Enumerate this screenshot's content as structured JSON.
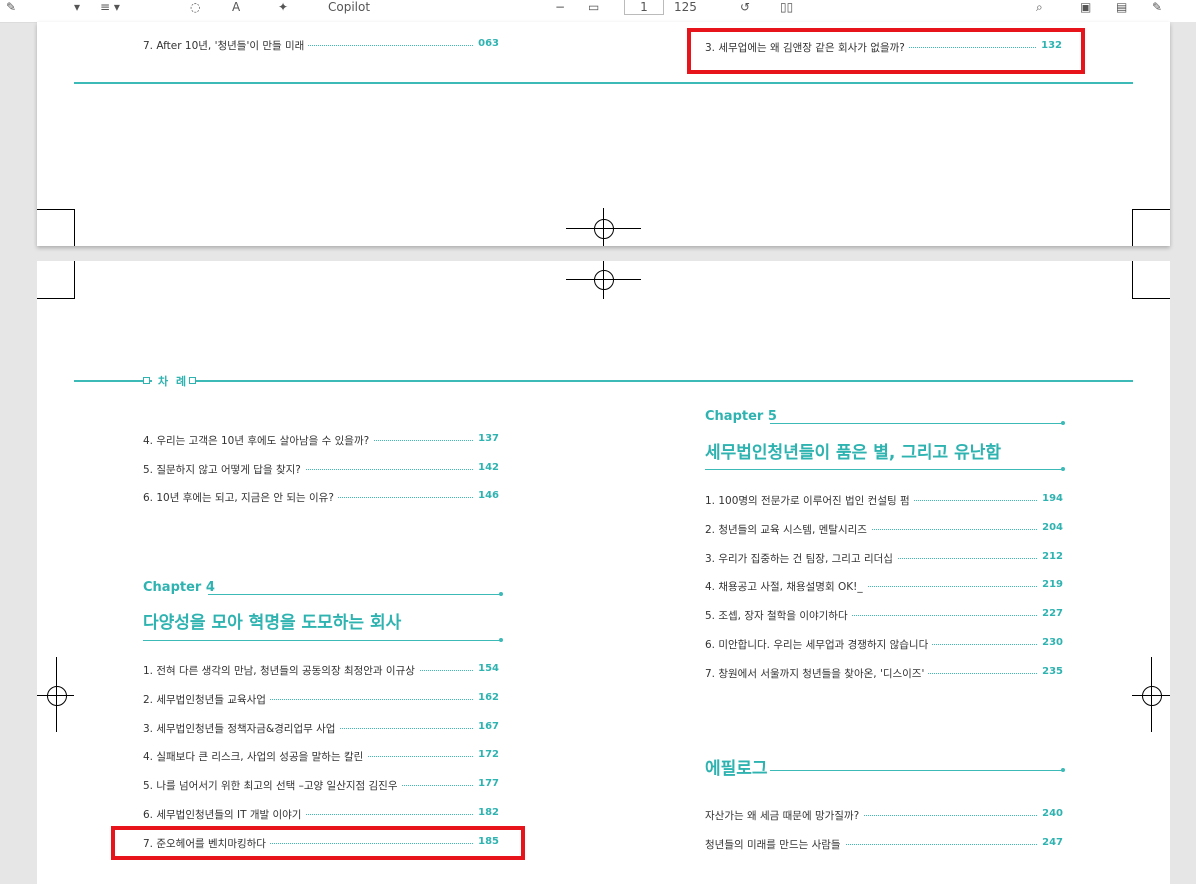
{
  "toolbar": {
    "copilot_label": "Copilot",
    "page_number": "1",
    "zoom": "125"
  },
  "colors": {
    "accent": "#2fb3b1",
    "highlight": "#e8141b"
  },
  "page1": {
    "left_item": {
      "text": "7. After 10년, '청년들'이 만들 미래",
      "page": "063"
    },
    "right_item": {
      "text": "3. 세무업에는 왜 김앤장 같은 회사가 없을까?",
      "page": "132"
    }
  },
  "page2": {
    "toc_label": "차 례",
    "left_items_top": [
      {
        "text": "4. 우리는 고객은 10년 후에도 살아남을 수 있을까?",
        "page": "137"
      },
      {
        "text": "5. 질문하지 않고 어떻게 답을 찾지?",
        "page": "142"
      },
      {
        "text": "6. 10년 후에는 되고, 지금은 안 되는 이유?",
        "page": "146"
      }
    ],
    "chapter4": {
      "label": "Chapter 4",
      "title": "다양성을 모아 혁명을 도모하는 회사",
      "items": [
        {
          "text": "1. 전혀 다른 생각의 만남, 청년들의 공동의장 최정안과 이규상",
          "page": "154"
        },
        {
          "text": "2. 세무법인청년들 교육사업",
          "page": "162"
        },
        {
          "text": "3. 세무법인청년들 정책자금&경리업무 사업",
          "page": "167"
        },
        {
          "text": "4. 실패보다 큰 리스크, 사업의 성공을 말하는 칼린",
          "page": "172"
        },
        {
          "text": "5. 나를 넘어서기 위한 최고의 선택 –고양 일산지점 김진우",
          "page": "177"
        },
        {
          "text": "6. 세무법인청년들의 IT 개발 이야기",
          "page": "182"
        },
        {
          "text": "7. 준오헤어를 벤치마킹하다",
          "page": "185"
        }
      ]
    },
    "chapter5": {
      "label": "Chapter 5",
      "title": "세무법인청년들이 품은 별, 그리고 유난함",
      "items": [
        {
          "text": "1. 100명의 전문가로 이루어진 법인 컨설팅 펌",
          "page": "194"
        },
        {
          "text": "2. 청년들의 교육 시스템, 멘탈시리즈",
          "page": "204"
        },
        {
          "text": "3. 우리가 집중하는 건 팀장, 그리고 리더십",
          "page": "212"
        },
        {
          "text": "4. 채용공고 사절, 채용설명회 OK!_",
          "page": "219"
        },
        {
          "text": "5. 조셉, 장자 철학을 이야기하다",
          "page": "227"
        },
        {
          "text": "6. 미안합니다. 우리는 세무업과 경쟁하지 않습니다",
          "page": "230"
        },
        {
          "text": "7. 창원에서 서울까지 청년들을 찾아온, '디스이즈'",
          "page": "235"
        }
      ]
    },
    "epilogue": {
      "title": "에필로그",
      "items": [
        {
          "text": "자산가는 왜 세금 때문에 망가질까?",
          "page": "240"
        },
        {
          "text": "청년들의 미래를 만드는 사람들",
          "page": "247"
        }
      ]
    }
  }
}
